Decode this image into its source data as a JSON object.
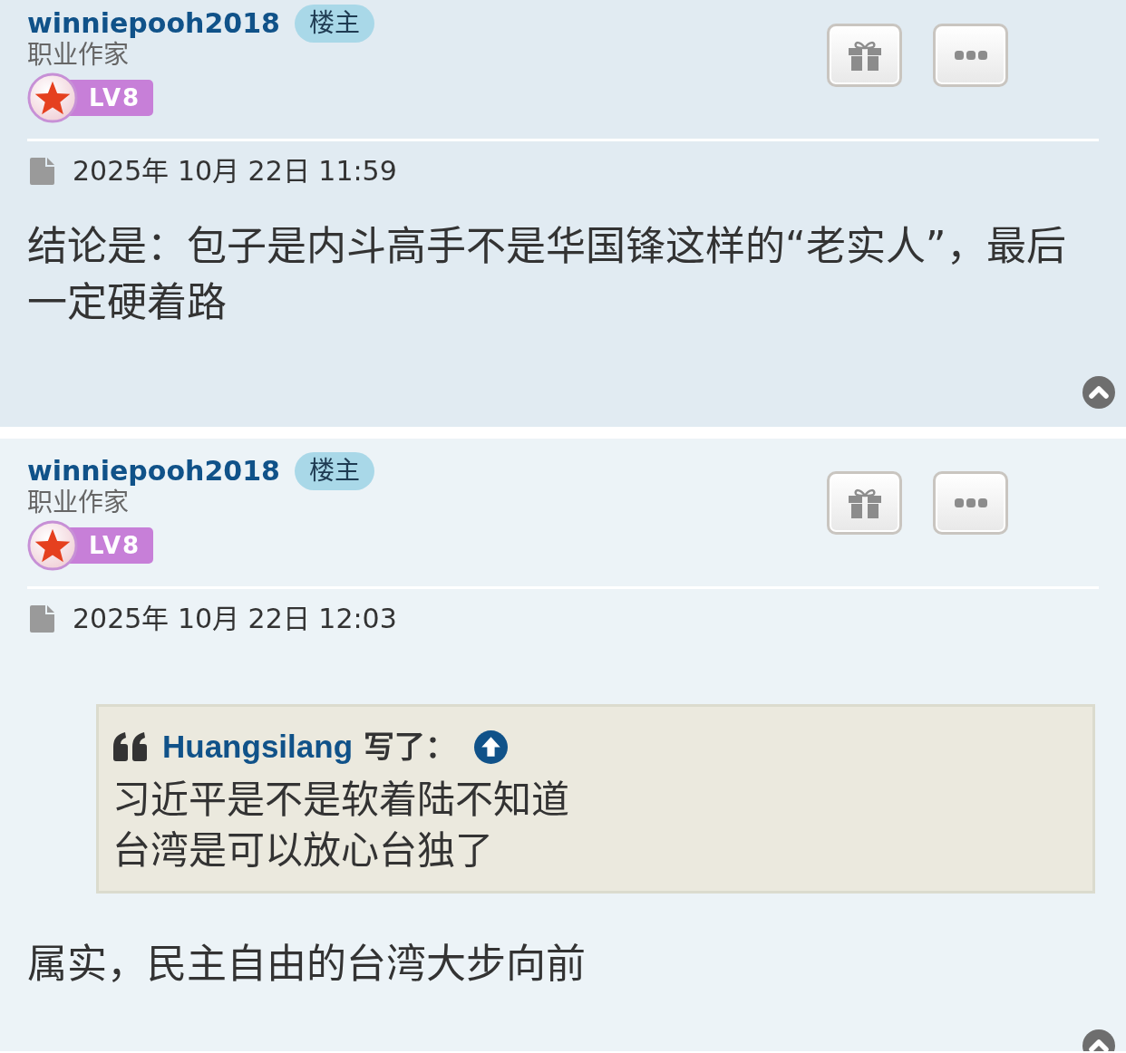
{
  "posts": [
    {
      "author": "winniepooh2018",
      "author_badge": "楼主",
      "rank_title": "职业作家",
      "rank_level": "LV8",
      "date": "2025年 10月 22日 11:59",
      "content": "结论是：包子是内斗高手不是华国锋这样的“老实人”，最后一定硬着路"
    },
    {
      "author": "winniepooh2018",
      "author_badge": "楼主",
      "rank_title": "职业作家",
      "rank_level": "LV8",
      "date": "2025年 10月 22日 12:03",
      "quote": {
        "author": "Huangsilang",
        "wrote": "写了：",
        "lines": [
          "习近平是不是软着陆不知道",
          "台湾是可以放心台独了"
        ]
      },
      "content": "属实，民主自由的台湾大步向前"
    }
  ]
}
